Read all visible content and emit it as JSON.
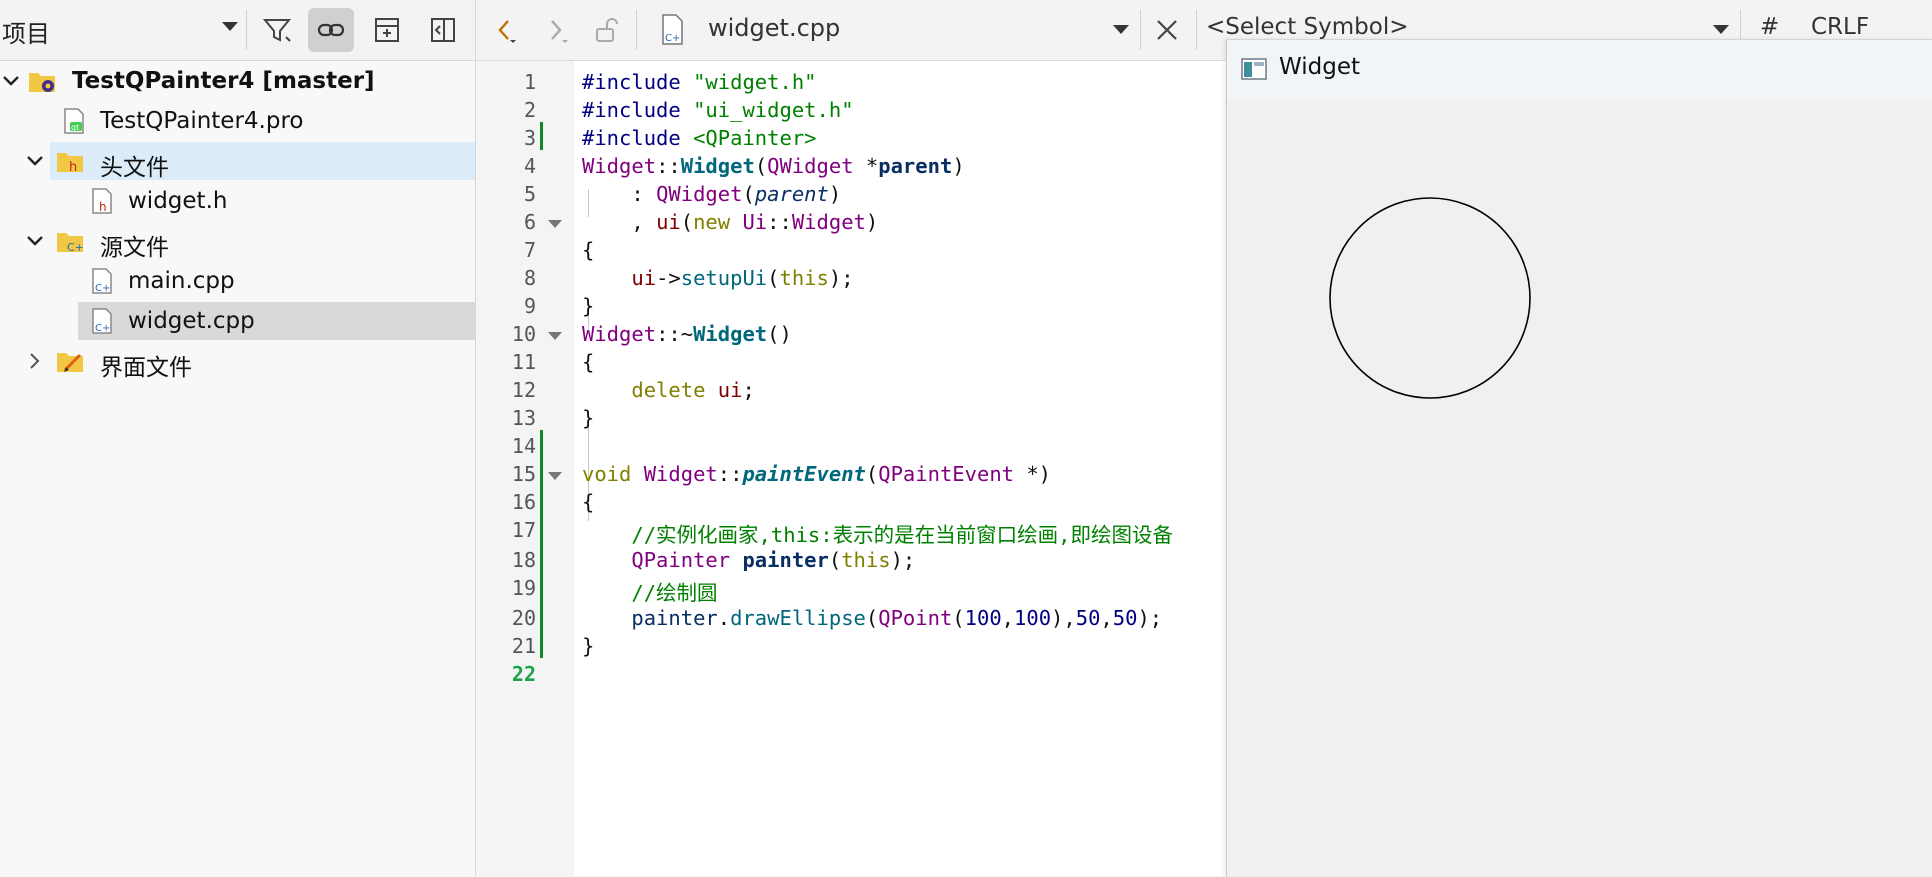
{
  "project_panel": {
    "selector_label": "项目",
    "tree": [
      {
        "label": "TestQPainter4 [master]",
        "icon": "qt-project-folder-icon",
        "expanded": true
      },
      {
        "label": "TestQPainter4.pro",
        "icon": "qt-pro-file-icon"
      },
      {
        "label": "头文件",
        "icon": "header-folder-icon",
        "expanded": true
      },
      {
        "label": "widget.h",
        "icon": "header-file-icon"
      },
      {
        "label": "源文件",
        "icon": "source-folder-icon",
        "expanded": true
      },
      {
        "label": "main.cpp",
        "icon": "cpp-file-icon"
      },
      {
        "label": "widget.cpp",
        "icon": "cpp-file-icon",
        "selected": true
      },
      {
        "label": "界面文件",
        "icon": "forms-folder-icon",
        "expanded": false
      }
    ]
  },
  "editor": {
    "file_name": "widget.cpp",
    "symbol_placeholder": "<Select Symbol>",
    "hash_label": "#",
    "line_ending": "CRLF",
    "current_line": 22,
    "line_numbers": [
      "1",
      "2",
      "3",
      "4",
      "5",
      "6",
      "7",
      "8",
      "9",
      "10",
      "11",
      "12",
      "13",
      "14",
      "15",
      "16",
      "17",
      "18",
      "19",
      "20",
      "21",
      "22"
    ],
    "code": {
      "l1a": "#include ",
      "l1b": "\"widget.h\"",
      "l2a": "#include ",
      "l2b": "\"ui_widget.h\"",
      "l3a": "#include ",
      "l3b": "<QPainter>",
      "l4a": "Widget",
      "l4b": "::",
      "l4c": "Widget",
      "l4d": "(",
      "l4e": "QWidget",
      "l4f": " *",
      "l4g": "parent",
      "l4h": ")",
      "l5a": "    : ",
      "l5b": "QWidget",
      "l5c": "(",
      "l5d": "parent",
      "l5e": ")",
      "l6a": "    , ",
      "l6b": "ui",
      "l6c": "(",
      "l6d": "new",
      "l6e": " ",
      "l6f": "Ui",
      "l6g": "::",
      "l6h": "Widget",
      "l6i": ")",
      "l7": "{",
      "l8a": "    ",
      "l8b": "ui",
      "l8c": "->",
      "l8d": "setupUi",
      "l8e": "(",
      "l8f": "this",
      "l8g": ");",
      "l9": "}",
      "l10a": "Widget",
      "l10b": "::~",
      "l10c": "Widget",
      "l10d": "()",
      "l11": "{",
      "l12a": "    ",
      "l12b": "delete",
      "l12c": " ",
      "l12d": "ui",
      "l12e": ";",
      "l13": "}",
      "l15a": "void",
      "l15b": " ",
      "l15c": "Widget",
      "l15d": "::",
      "l15e": "paintEvent",
      "l15f": "(",
      "l15g": "QPaintEvent",
      "l15h": " *)",
      "l16": "{",
      "l17a": "    ",
      "l17b": "//实例化画家,this:表示的是在当前窗口绘画,即绘图设备",
      "l18a": "    ",
      "l18b": "QPainter",
      "l18c": " ",
      "l18d": "painter",
      "l18e": "(",
      "l18f": "this",
      "l18g": ");",
      "l19a": "    ",
      "l19b": "//绘制圆",
      "l20a": "    ",
      "l20b": "painter",
      "l20c": ".",
      "l20d": "drawEllipse",
      "l20e": "(",
      "l20f": "QPoint",
      "l20g": "(",
      "l20h": "100",
      "l20i": ",",
      "l20j": "100",
      "l20k": "),",
      "l20l": "50",
      "l20m": ",",
      "l20n": "50",
      "l20o": ");",
      "l21": "}"
    }
  },
  "widget_window": {
    "title": "Widget",
    "shape": "circle"
  },
  "colors": {
    "selection": "#dcebf8",
    "selected_file": "#d9d9d9",
    "change_marker": "#0f8a2a",
    "current_line_number": "#1aa24a"
  }
}
